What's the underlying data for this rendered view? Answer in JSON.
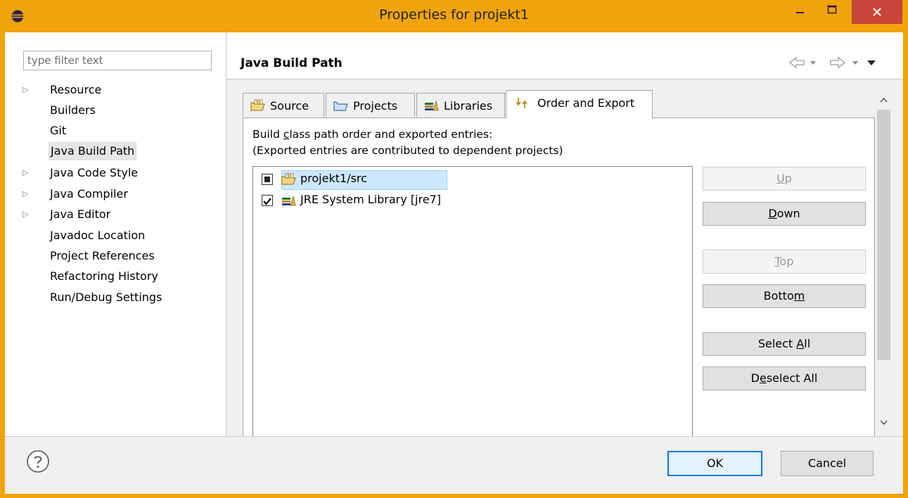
{
  "window": {
    "title": "Properties for projekt1",
    "accent_color": "#f0a30a",
    "close_color": "#c7453a"
  },
  "filter": {
    "placeholder": "type filter text"
  },
  "tree": {
    "items": [
      {
        "label": "Resource",
        "expandable": true
      },
      {
        "label": "Builders",
        "expandable": false
      },
      {
        "label": "Git",
        "expandable": false
      },
      {
        "label": "Java Build Path",
        "expandable": false,
        "selected": true
      },
      {
        "label": "Java Code Style",
        "expandable": true
      },
      {
        "label": "Java Compiler",
        "expandable": true
      },
      {
        "label": "Java Editor",
        "expandable": true
      },
      {
        "label": "Javadoc Location",
        "expandable": false
      },
      {
        "label": "Project References",
        "expandable": false
      },
      {
        "label": "Refactoring History",
        "expandable": false
      },
      {
        "label": "Run/Debug Settings",
        "expandable": false
      }
    ]
  },
  "page": {
    "title": "Java Build Path"
  },
  "tabs": [
    {
      "label": "Source",
      "icon": "source-folder-icon"
    },
    {
      "label": "Projects",
      "icon": "folder-icon"
    },
    {
      "label": "Libraries",
      "icon": "library-icon"
    },
    {
      "label": "Order and Export",
      "icon": "order-export-icon",
      "active": true
    }
  ],
  "order_export": {
    "desc_line1_pre": "Build ",
    "desc_line1_mnemonic": "c",
    "desc_line1_post": "lass path order and exported entries:",
    "desc_line2": "(Exported entries are contributed to dependent projects)",
    "entries": [
      {
        "label": "projekt1/src",
        "checked": "partial",
        "icon": "source-folder-icon"
      },
      {
        "label": "JRE System Library [jre7]",
        "checked": true,
        "icon": "library-icon"
      }
    ],
    "buttons": {
      "up": {
        "pre": "",
        "mn": "U",
        "post": "p",
        "enabled": false
      },
      "down": {
        "pre": "",
        "mn": "D",
        "post": "own",
        "enabled": true
      },
      "top": {
        "pre": "",
        "mn": "T",
        "post": "op",
        "enabled": false
      },
      "bottom": {
        "pre": "Botto",
        "mn": "m",
        "post": "",
        "enabled": true
      },
      "select_all": {
        "pre": "Select ",
        "mn": "A",
        "post": "ll",
        "enabled": true
      },
      "deselect_all": {
        "pre": "D",
        "mn": "e",
        "post": "select All",
        "enabled": true
      }
    }
  },
  "footer": {
    "ok_label": "OK",
    "cancel_label": "Cancel"
  }
}
